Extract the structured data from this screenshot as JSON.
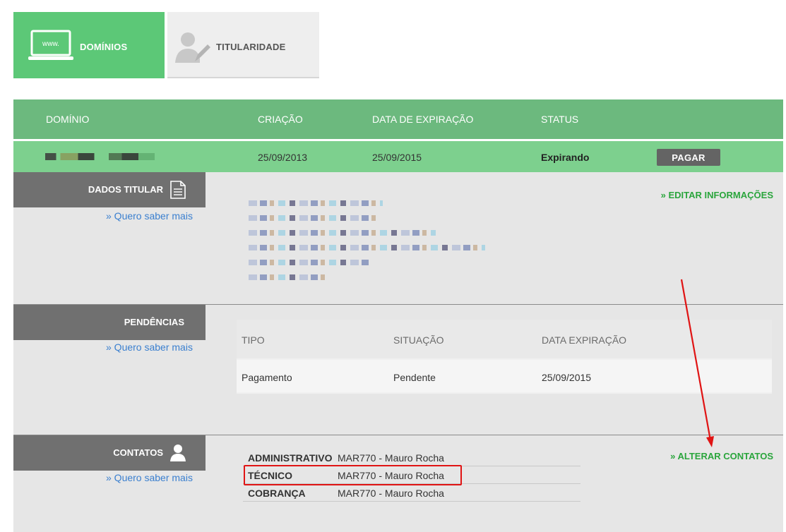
{
  "tabs": [
    {
      "label": "DOMÍNIOS",
      "icon": "laptop-www-icon",
      "active": true
    },
    {
      "label": "TITULARIDADE",
      "icon": "user-edit-icon",
      "active": false
    }
  ],
  "icon_text": "www.",
  "table": {
    "headers": [
      "DOMÍNIO",
      "CRIAÇÃO",
      "DATA DE EXPIRAÇÃO",
      "STATUS"
    ],
    "row": {
      "created": "25/09/2013",
      "expires": "25/09/2015",
      "status": "Expirando",
      "pay_label": "PAGAR"
    }
  },
  "sections": {
    "holder": {
      "label": "DADOS TITULAR",
      "more_link": "» Quero saber mais",
      "action": "» EDITAR INFORMAÇÕES"
    },
    "pending": {
      "label": "PENDÊNCIAS",
      "more_link": "» Quero saber mais",
      "columns": [
        "TIPO",
        "SITUAÇÃO",
        "DATA EXPIRAÇÃO"
      ],
      "rows": [
        {
          "type": "Pagamento",
          "situation": "Pendente",
          "expiration": "25/09/2015"
        }
      ]
    },
    "contacts": {
      "label": "CONTATOS",
      "more_link": "» Quero saber mais",
      "action": "» ALTERAR CONTATOS",
      "items": [
        {
          "role": "ADMINISTRATIVO",
          "name": "MAR770 - Mauro Rocha"
        },
        {
          "role": "TÉCNICO",
          "name": "MAR770 - Mauro Rocha"
        },
        {
          "role": "COBRANÇA",
          "name": "MAR770 - Mauro Rocha"
        }
      ]
    }
  },
  "colors": {
    "active_tab": "#5cc877",
    "header": "#6cb97e",
    "row": "#7dd08e",
    "section_label": "#707070",
    "link_blue": "#3a7fcf",
    "link_green": "#2aa53c",
    "annotation_red": "#e01414"
  }
}
